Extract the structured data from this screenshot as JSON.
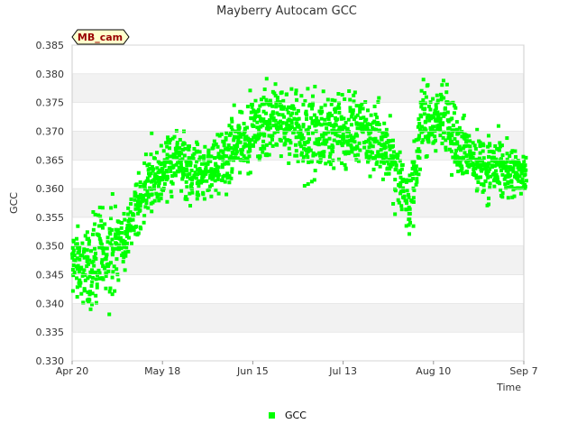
{
  "chart_data": {
    "type": "scatter",
    "title": "Mayberry Autocam GCC",
    "site_tag": "MB_cam",
    "xlabel": "Time",
    "ylabel": "GCC",
    "x_ticks": [
      "Apr 20",
      "May 18",
      "Jun 15",
      "Jul 13",
      "Aug 10",
      "Sep 7"
    ],
    "y_ticks": [
      "0.330",
      "0.335",
      "0.340",
      "0.345",
      "0.350",
      "0.355",
      "0.360",
      "0.365",
      "0.370",
      "0.375",
      "0.380",
      "0.385"
    ],
    "xlim": [
      "Apr 20",
      "Sep 7"
    ],
    "ylim": [
      0.33,
      0.385
    ],
    "grid": "horizontal bands",
    "legend_position": "bottom",
    "series": [
      {
        "name": "GCC",
        "color": "#00ff00",
        "marker": "square",
        "points_per_day": 14,
        "daily_trend": [
          {
            "x": "Apr 20",
            "y_min": 0.338,
            "y_max": 0.356
          },
          {
            "x": "Apr 24",
            "y_min": 0.337,
            "y_max": 0.355
          },
          {
            "x": "Apr 28",
            "y_min": 0.336,
            "y_max": 0.359
          },
          {
            "x": "May 2",
            "y_min": 0.338,
            "y_max": 0.361
          },
          {
            "x": "May 6",
            "y_min": 0.345,
            "y_max": 0.357
          },
          {
            "x": "May 10",
            "y_min": 0.35,
            "y_max": 0.364
          },
          {
            "x": "May 14",
            "y_min": 0.354,
            "y_max": 0.368
          },
          {
            "x": "May 18",
            "y_min": 0.356,
            "y_max": 0.371
          },
          {
            "x": "May 22",
            "y_min": 0.357,
            "y_max": 0.373
          },
          {
            "x": "May 26",
            "y_min": 0.352,
            "y_max": 0.372
          },
          {
            "x": "May 30",
            "y_min": 0.356,
            "y_max": 0.37
          },
          {
            "x": "Jun 3",
            "y_min": 0.357,
            "y_max": 0.371
          },
          {
            "x": "Jun 7",
            "y_min": 0.358,
            "y_max": 0.374
          },
          {
            "x": "Jun 11",
            "y_min": 0.36,
            "y_max": 0.378
          },
          {
            "x": "Jun 15",
            "y_min": 0.362,
            "y_max": 0.379
          },
          {
            "x": "Jun 19",
            "y_min": 0.363,
            "y_max": 0.38
          },
          {
            "x": "Jun 23",
            "y_min": 0.363,
            "y_max": 0.381
          },
          {
            "x": "Jun 27",
            "y_min": 0.362,
            "y_max": 0.38
          },
          {
            "x": "Jul 1",
            "y_min": 0.359,
            "y_max": 0.379
          },
          {
            "x": "Jul 5",
            "y_min": 0.358,
            "y_max": 0.381
          },
          {
            "x": "Jul 9",
            "y_min": 0.361,
            "y_max": 0.38
          },
          {
            "x": "Jul 13",
            "y_min": 0.361,
            "y_max": 0.379
          },
          {
            "x": "Jul 17",
            "y_min": 0.361,
            "y_max": 0.38
          },
          {
            "x": "Jul 21",
            "y_min": 0.361,
            "y_max": 0.379
          },
          {
            "x": "Jul 25",
            "y_min": 0.36,
            "y_max": 0.376
          },
          {
            "x": "Jul 29",
            "y_min": 0.355,
            "y_max": 0.372
          },
          {
            "x": "Aug 2",
            "y_min": 0.347,
            "y_max": 0.366
          },
          {
            "x": "Aug 6",
            "y_min": 0.363,
            "y_max": 0.381
          },
          {
            "x": "Aug 10",
            "y_min": 0.364,
            "y_max": 0.379
          },
          {
            "x": "Aug 14",
            "y_min": 0.362,
            "y_max": 0.381
          },
          {
            "x": "Aug 18",
            "y_min": 0.36,
            "y_max": 0.376
          },
          {
            "x": "Aug 22",
            "y_min": 0.357,
            "y_max": 0.372
          },
          {
            "x": "Aug 26",
            "y_min": 0.356,
            "y_max": 0.371
          },
          {
            "x": "Aug 30",
            "y_min": 0.357,
            "y_max": 0.371
          },
          {
            "x": "Sep 3",
            "y_min": 0.356,
            "y_max": 0.369
          },
          {
            "x": "Sep 7",
            "y_min": 0.357,
            "y_max": 0.368
          }
        ]
      }
    ]
  }
}
